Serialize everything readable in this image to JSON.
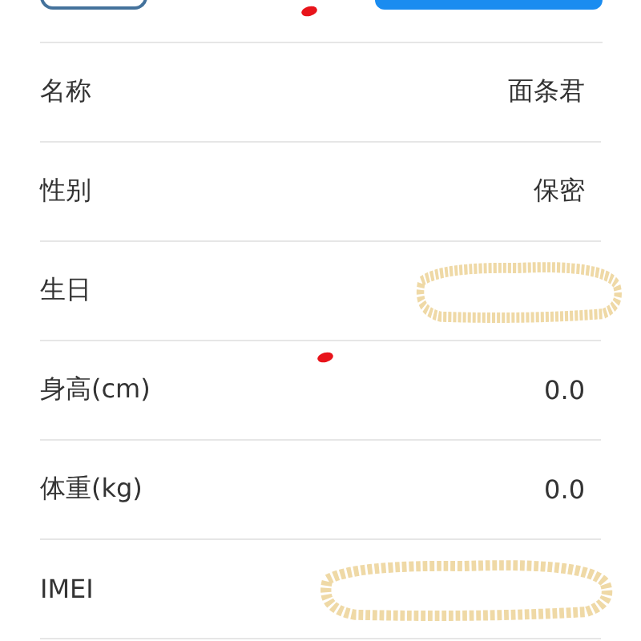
{
  "rows": [
    {
      "kind": "text",
      "label": "名称",
      "value": "面条君"
    },
    {
      "kind": "text",
      "label": "性别",
      "value": "保密"
    },
    {
      "kind": "redacted",
      "label": "生日"
    },
    {
      "kind": "text",
      "label": "身高(cm)",
      "value": "0.0"
    },
    {
      "kind": "text",
      "label": "体重(kg)",
      "value": "0.0"
    },
    {
      "kind": "redacted",
      "label": "IMEI"
    }
  ]
}
